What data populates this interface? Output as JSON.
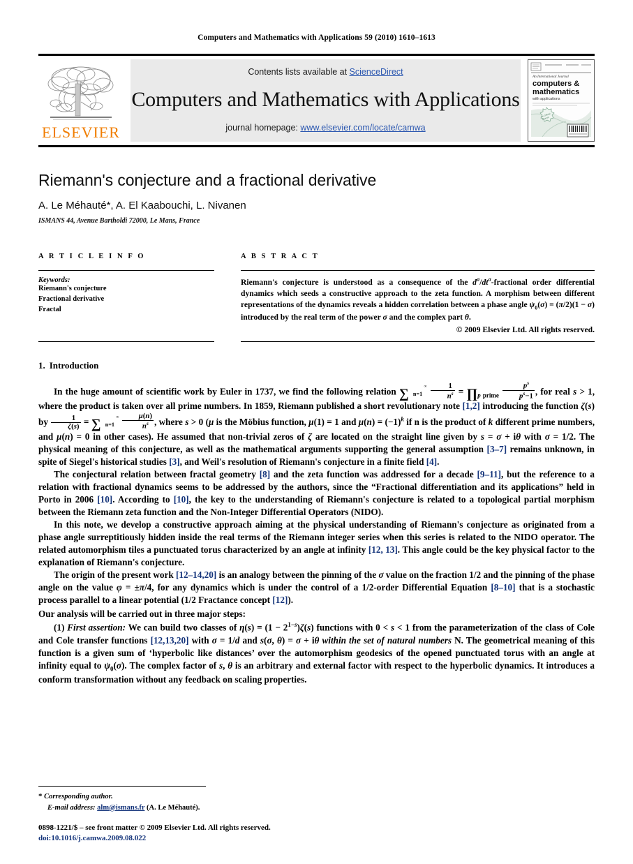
{
  "running_head": "Computers and Mathematics with Applications 59 (2010) 1610–1613",
  "masthead": {
    "contents_prefix": "Contents lists available at ",
    "sciencedirect": "ScienceDirect",
    "journal_title": "Computers and Mathematics with Applications",
    "homepage_prefix": "journal homepage: ",
    "homepage_url": "www.elsevier.com/locate/camwa",
    "publisher_logo_text": "ELSEVIER",
    "cover": {
      "line1": "An International Journal",
      "line2": "computers &",
      "line3": "mathematics",
      "line4": "with applications"
    },
    "colors": {
      "link": "#2b57b0",
      "elsevier_orange": "#f07d00",
      "band_bg": "#eaeaea"
    }
  },
  "article": {
    "title": "Riemann's conjecture and a fractional derivative",
    "authors": "A. Le Méhauté*, A. El Kaabouchi, L. Nivanen",
    "affiliation": "ISMANS 44, Avenue Bartholdi 72000, Le Mans, France"
  },
  "article_info": {
    "heading": "A R T I C L E    I N F O",
    "keywords_label": "Keywords:",
    "keywords": [
      "Riemann's conjecture",
      "Fractional derivative",
      "Fractal"
    ]
  },
  "abstract": {
    "heading": "A B S T R A C T",
    "copyright": "© 2009 Elsevier Ltd. All rights reserved."
  },
  "sections": {
    "intro_number": "1.",
    "intro_title": "Introduction",
    "steps_lead": "Our analysis will be carried out in three major steps:"
  },
  "footnotes": {
    "corresponding": "Corresponding author.",
    "email_label": "E-mail address:",
    "email": "alm@ismans.fr",
    "email_owner": "(A. Le Méhauté).",
    "issn_line": "0898-1221/$ – see front matter © 2009 Elsevier Ltd. All rights reserved.",
    "doi_line": "doi:10.1016/j.camwa.2009.08.022"
  }
}
